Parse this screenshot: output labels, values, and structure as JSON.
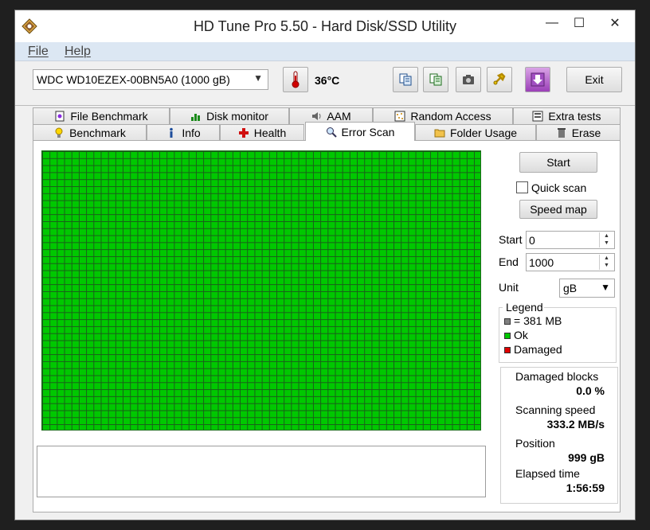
{
  "window": {
    "title": "HD Tune Pro 5.50 - Hard Disk/SSD Utility",
    "min_glyph": "—",
    "max_glyph": "☐",
    "close_glyph": "✕"
  },
  "menu": {
    "file": "File",
    "help": "Help"
  },
  "toolbar": {
    "drive": "WDC WD10EZEX-00BN5A0 (1000 gB)",
    "temperature": "36°C",
    "exit_label": "Exit"
  },
  "tabs_row1": [
    {
      "label": "File Benchmark",
      "icon": "file-benchmark-icon"
    },
    {
      "label": "Disk monitor",
      "icon": "disk-monitor-icon"
    },
    {
      "label": "AAM",
      "icon": "speaker-icon"
    },
    {
      "label": "Random Access",
      "icon": "random-access-icon"
    },
    {
      "label": "Extra tests",
      "icon": "extra-tests-icon"
    }
  ],
  "tabs_row2": [
    {
      "label": "Benchmark",
      "icon": "lightbulb-icon"
    },
    {
      "label": "Info",
      "icon": "info-icon"
    },
    {
      "label": "Health",
      "icon": "health-cross-icon"
    },
    {
      "label": "Error Scan",
      "icon": "magnifier-icon",
      "active": true
    },
    {
      "label": "Folder Usage",
      "icon": "folder-icon"
    },
    {
      "label": "Erase",
      "icon": "trash-icon"
    }
  ],
  "scan": {
    "start_button": "Start",
    "quick_scan_label": "Quick scan",
    "quick_scan_checked": false,
    "speed_map_button": "Speed map",
    "start_label": "Start",
    "start_value": "0",
    "end_label": "End",
    "end_value": "1000",
    "unit_label": "Unit",
    "unit_value": "gB"
  },
  "legend": {
    "title": "Legend",
    "block_size": "= 381 MB",
    "ok": "Ok",
    "damaged": "Damaged",
    "colors": {
      "block": "#808080",
      "ok": "#00c800",
      "damaged": "#e00000"
    }
  },
  "stats": {
    "damaged_blocks_label": "Damaged blocks",
    "damaged_blocks_value": "0.0 %",
    "scanning_speed_label": "Scanning speed",
    "scanning_speed_value": "333.2 MB/s",
    "position_label": "Position",
    "position_value": "999 gB",
    "elapsed_label": "Elapsed time",
    "elapsed_value": "1:56:59"
  }
}
